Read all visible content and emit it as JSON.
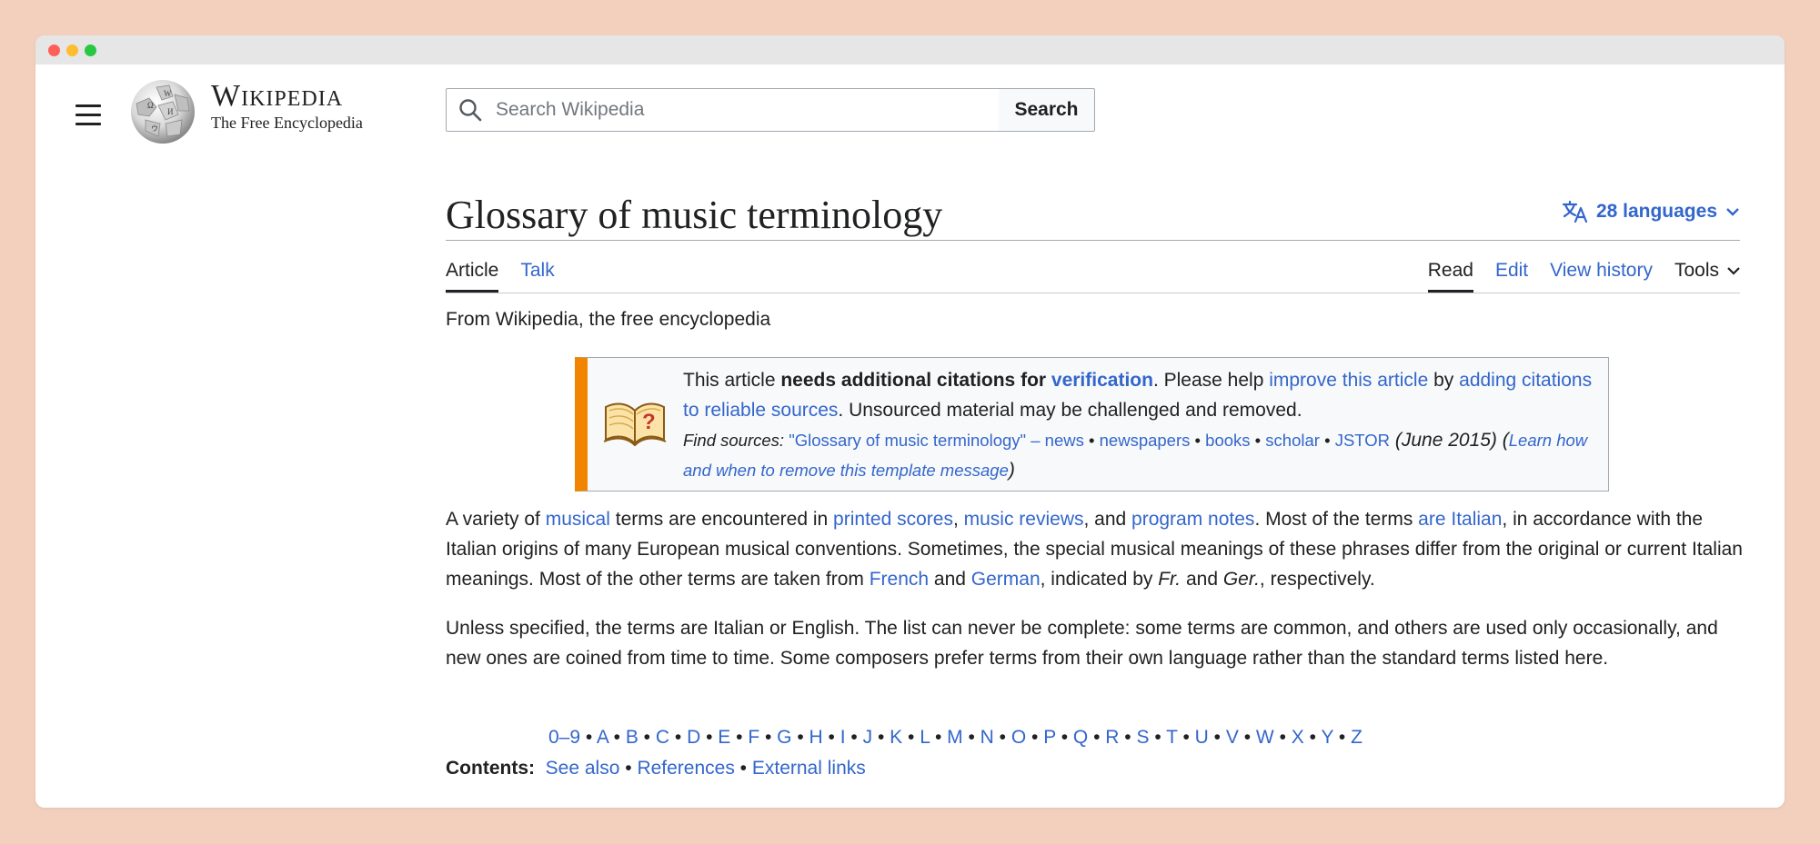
{
  "header": {
    "wordmark_title": "Wikipedia",
    "wordmark_tagline": "The Free Encyclopedia",
    "search_placeholder": "Search Wikipedia",
    "search_button": "Search"
  },
  "title": {
    "text": "Glossary of music terminology",
    "languages": "28 languages"
  },
  "tabs_left": [
    "Article",
    "Talk"
  ],
  "tabs_right": [
    "Read",
    "Edit",
    "View history",
    "Tools"
  ],
  "tagline": "From Wikipedia, the free encyclopedia",
  "ambox": {
    "t1": "This article ",
    "t2": "needs additional citations for ",
    "l1": "verification",
    "t3": ". Please help ",
    "l2": "improve this article",
    "t4": " by ",
    "l3": "adding citations to reliable sources",
    "t5": ". Unsourced material may be challenged and removed.",
    "find": "Find sources: ",
    "s1": "\"Glossary of music terminology\" – news",
    "s2": "newspapers",
    "s3": "books",
    "s4": "scholar",
    "s5": "JSTOR",
    "date": " (June 2015) (",
    "learn": "Learn how and when to remove this template message",
    "close": ")"
  },
  "para1": {
    "a": "A variety of ",
    "l1": "musical",
    "b": " terms are encountered in ",
    "l2": "printed scores",
    "c": ", ",
    "l3": "music reviews",
    "d": ", and ",
    "l4": "program notes",
    "e": ". Most of the terms ",
    "l5": "are Italian",
    "f": ", in accordance with the Italian origins of many European musical conventions. Sometimes, the special musical meanings of these phrases differ from the original or current Italian meanings. Most of the other terms are taken from ",
    "l6": "French",
    "g": " and ",
    "l7": "German",
    "h": ", indicated by ",
    "i1": "Fr.",
    "i": " and ",
    "i2": "Ger.",
    "j": ", respectively."
  },
  "para2": "Unless specified, the terms are Italian or English. The list can never be complete: some terms are common, and others are used only occasionally, and new ones are coined from time to time. Some composers prefer terms from their own language rather than the standard terms listed here.",
  "alphabet": [
    "0–9",
    "A",
    "B",
    "C",
    "D",
    "E",
    "F",
    "G",
    "H",
    "I",
    "J",
    "K",
    "L",
    "M",
    "N",
    "O",
    "P",
    "Q",
    "R",
    "S",
    "T",
    "U",
    "V",
    "W",
    "X",
    "Y",
    "Z"
  ],
  "contents": {
    "label": "Contents:",
    "links": [
      "See also",
      "References",
      "External links"
    ]
  },
  "colors": {
    "link": "#3366cc",
    "ambox_border": "#f28500",
    "background": "#f2d0bd"
  },
  "icons": [
    "hamburger-menu-icon",
    "wikipedia-globe-logo",
    "search-icon",
    "translate-icon",
    "chevron-down-icon",
    "open-book-question-icon"
  ]
}
